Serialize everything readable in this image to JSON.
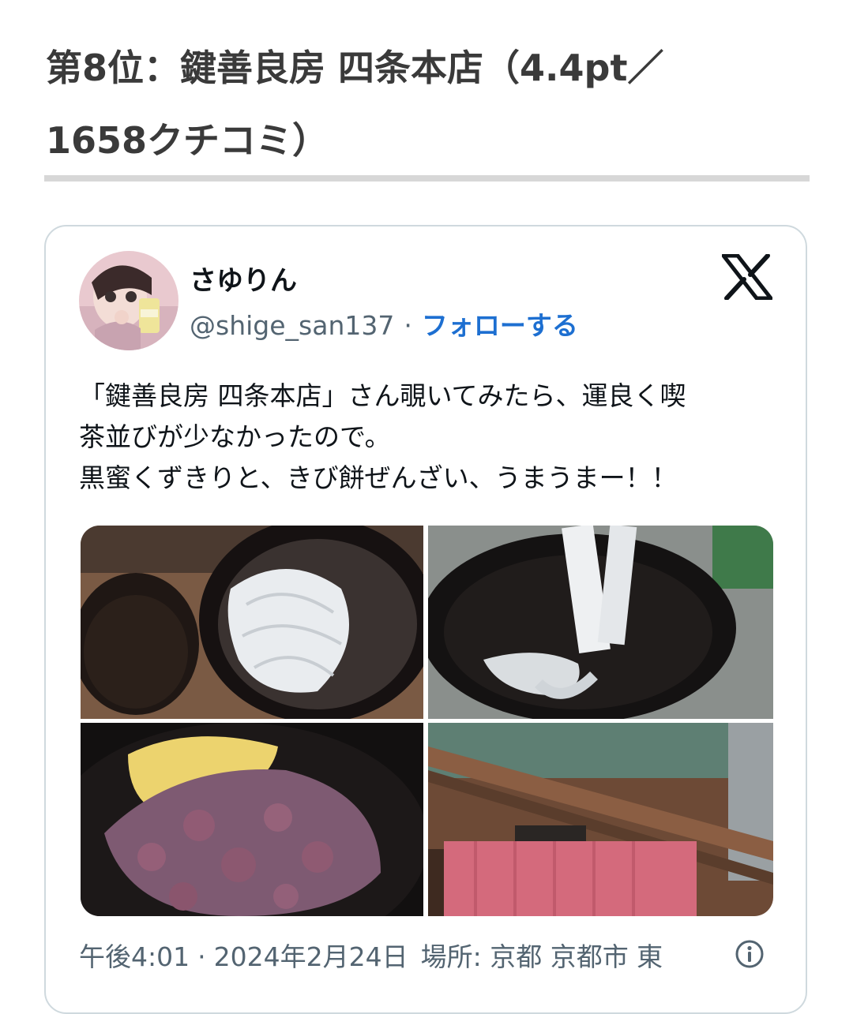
{
  "heading": {
    "line1": "第8位：鍵善良房 四条本店（4.4pt／",
    "line2": "1658クチコミ）"
  },
  "tweet": {
    "user_name": "さゆりん",
    "handle": "@shige_san137",
    "separator": "·",
    "follow_label": "フォローする",
    "text_lines": [
      "「鍵善良房 四条本店」さん覗いてみたら、運良く喫",
      "茶並びが少なかったので。",
      "黒蜜くずきりと、きび餅ぜんざい、うまうまー！！"
    ],
    "time": "午後4:01",
    "date": "2024年2月24日",
    "location": "場所: 京都 京都市 東",
    "photos": [
      "kuzukiri-bowl-photo",
      "kuzukiri-lifted-photo",
      "zenzai-photo",
      "shop-front-photo"
    ]
  },
  "icons": {
    "x_logo": "x-logo-icon",
    "info": "info-icon"
  },
  "colors": {
    "follow": "#1d6fd1",
    "secondary_text": "#536471",
    "rule": "#d7d7d7",
    "card_border": "#cfd9de"
  }
}
